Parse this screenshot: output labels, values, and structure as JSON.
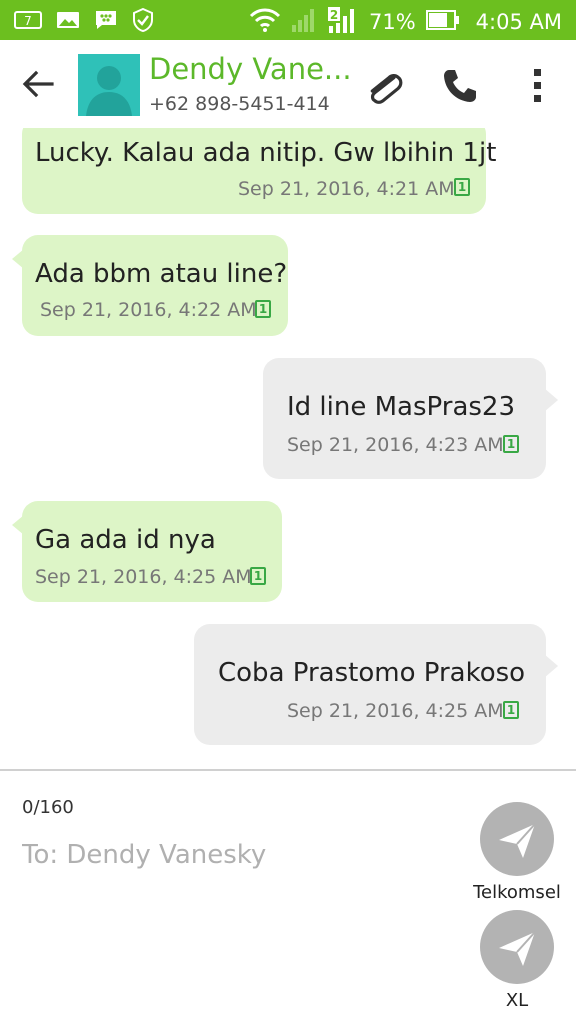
{
  "status_bar": {
    "notification_count": "7",
    "sim_slot": "2",
    "battery": "71%",
    "time": "4:05 AM",
    "color": "#6cbf1f"
  },
  "header": {
    "contact_name": "Dendy Vane...",
    "contact_number": "+62 898-5451-414"
  },
  "messages": [
    {
      "direction": "in",
      "text": "Lucky. Kalau ada nitip. Gw lbihin 1jt",
      "time": "Sep 21, 2016, 4:21 AM",
      "sim": "1"
    },
    {
      "direction": "in",
      "text": "Ada bbm atau line?",
      "time": "Sep 21, 2016, 4:22 AM",
      "sim": "1"
    },
    {
      "direction": "out",
      "text": "Id line MasPras23",
      "time": "Sep 21, 2016, 4:23 AM",
      "sim": "1"
    },
    {
      "direction": "in",
      "text": "Ga ada id nya",
      "time": "Sep 21, 2016, 4:25 AM",
      "sim": "1"
    },
    {
      "direction": "out",
      "text": "Coba Prastomo Prakoso",
      "time": "Sep 21, 2016, 4:25 AM",
      "sim": "1"
    }
  ],
  "composer": {
    "counter": "0/160",
    "placeholder": "To: Dendy Vanesky",
    "sim_buttons": [
      {
        "label": "Telkomsel"
      },
      {
        "label": "XL"
      }
    ]
  },
  "colors": {
    "incoming_bubble": "#ddf5c7",
    "outgoing_bubble": "#ececec",
    "accent": "#5cb82a"
  }
}
